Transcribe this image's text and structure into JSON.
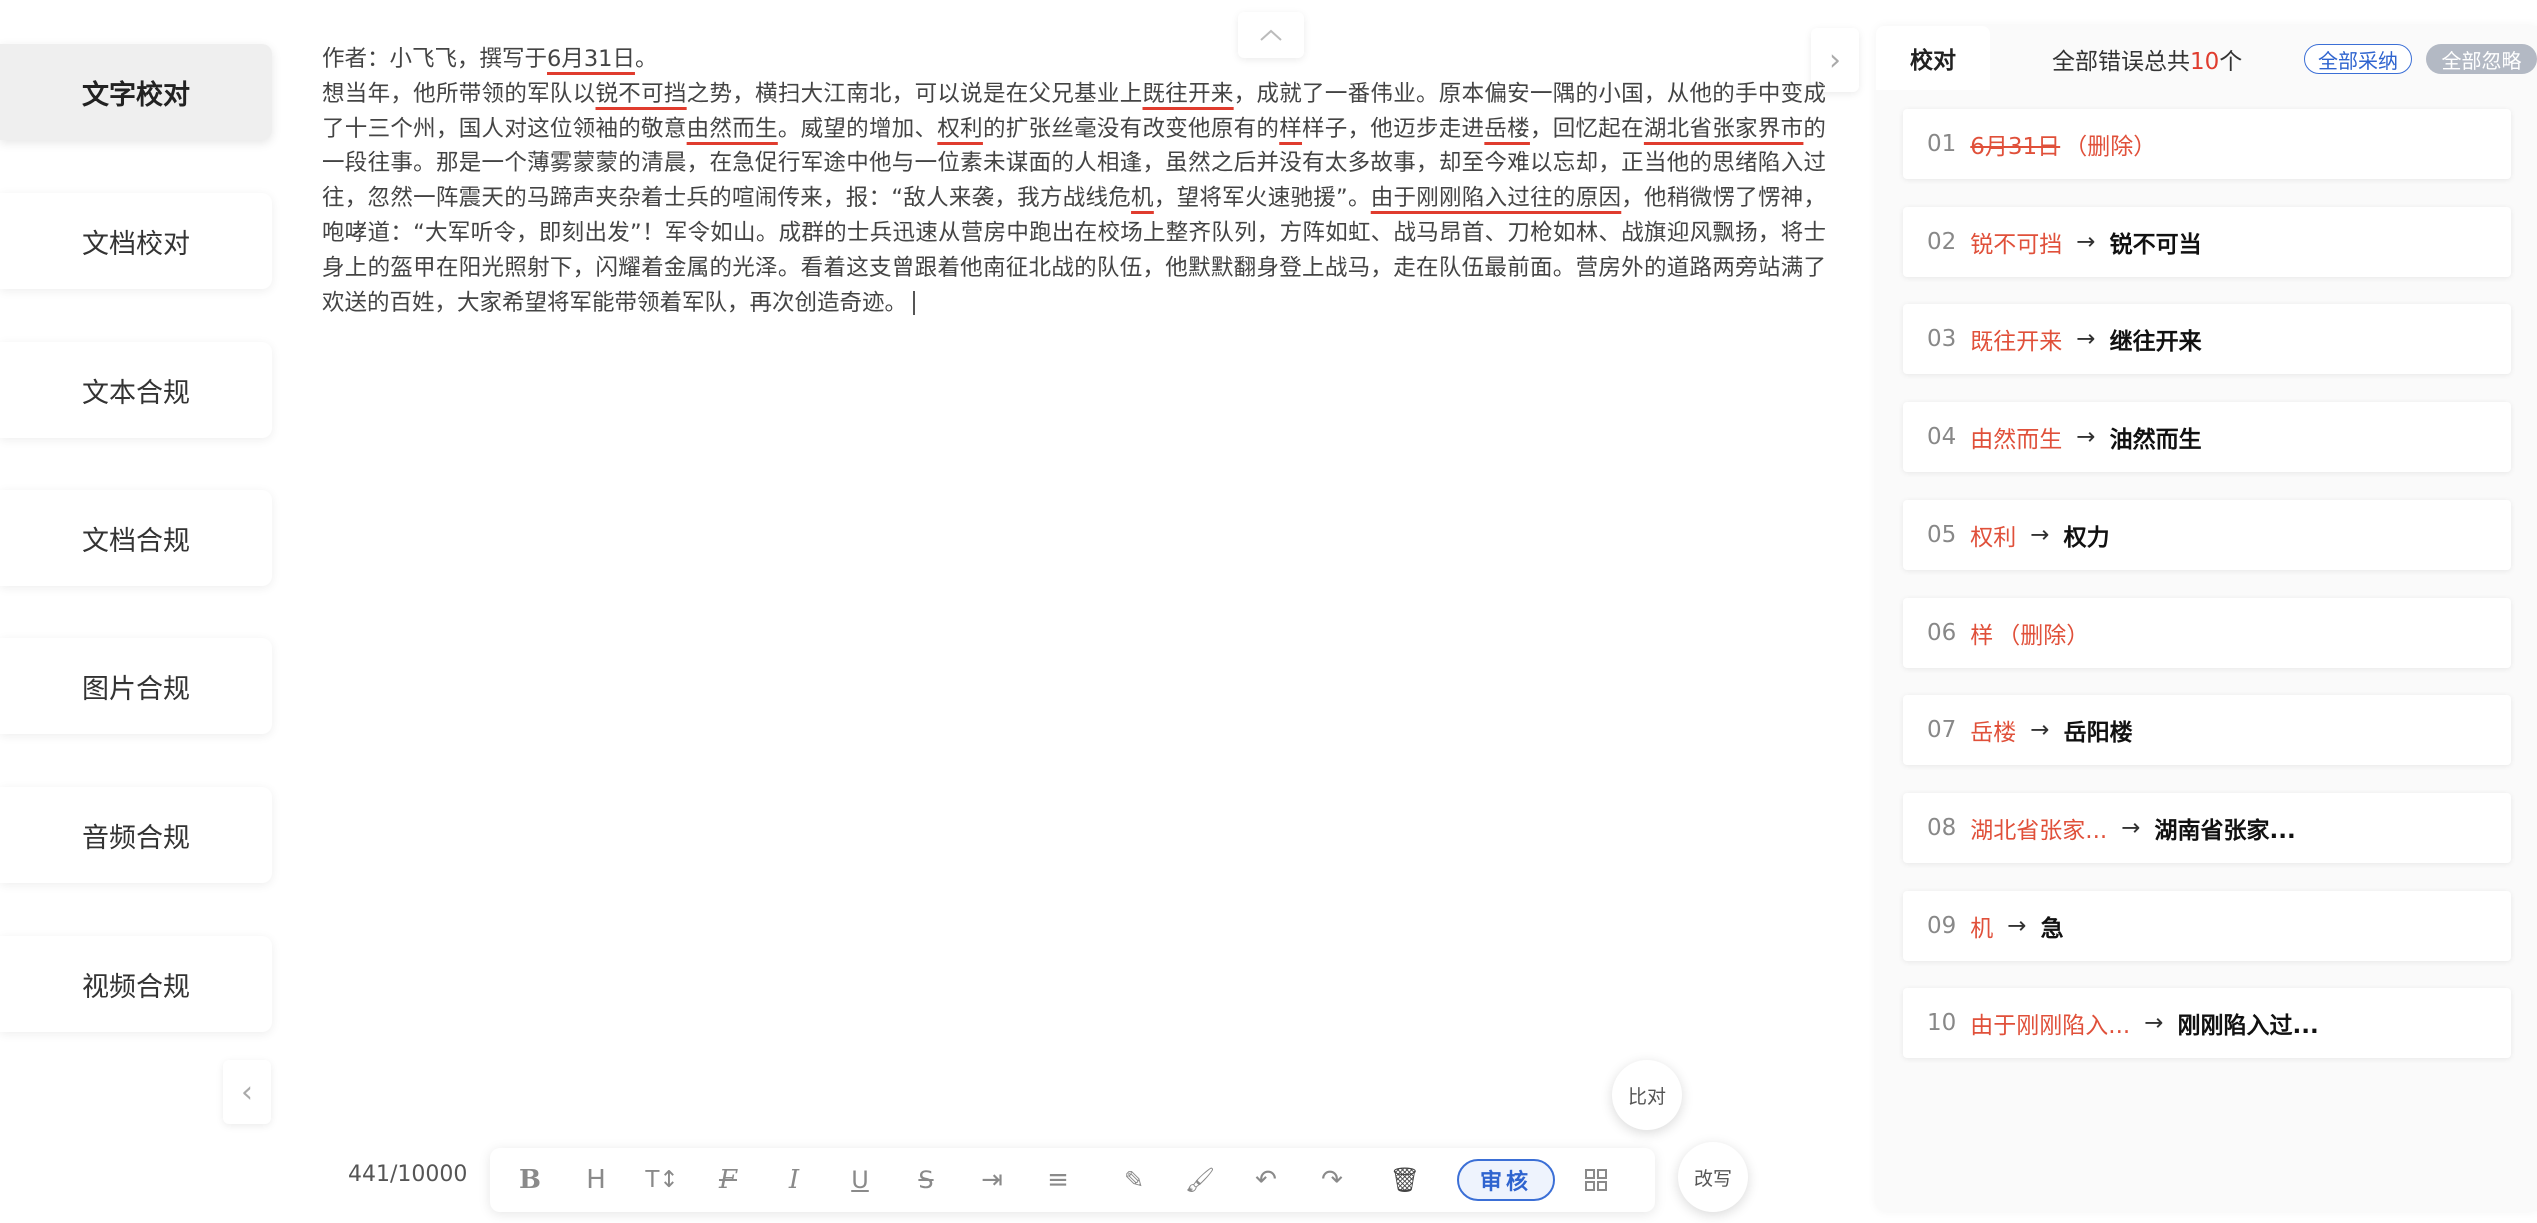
{
  "nav": {
    "items": [
      {
        "label": "文字校对",
        "active": true
      },
      {
        "label": "文档校对",
        "active": false
      },
      {
        "label": "文本合规",
        "active": false
      },
      {
        "label": "文档合规",
        "active": false
      },
      {
        "label": "图片合规",
        "active": false
      },
      {
        "label": "音频合规",
        "active": false
      },
      {
        "label": "视频合规",
        "active": false
      }
    ]
  },
  "editor": {
    "segments": [
      [
        "作者：小飞飞，撰写于",
        false
      ],
      [
        "6月31日",
        true
      ],
      [
        "。",
        false
      ],
      [
        "\n",
        false
      ],
      [
        "想当年，他所带领的军队以",
        false
      ],
      [
        "锐不可挡",
        true
      ],
      [
        "之势，横扫大江南北，可以说是在父兄基业上",
        false
      ],
      [
        "既往开来",
        true
      ],
      [
        "，成就了一番伟业。原本偏安一隅的小国，从他的手中变成了十三个州，国人对这位领袖的敬意",
        false
      ],
      [
        "由然而生",
        true
      ],
      [
        "。威望的增加、",
        false
      ],
      [
        "权利",
        true
      ],
      [
        "的扩张丝毫没有改变他原有的",
        false
      ],
      [
        "样",
        true
      ],
      [
        "样子，他迈步走进",
        false
      ],
      [
        "岳楼",
        true
      ],
      [
        "，回忆起在",
        false
      ],
      [
        "湖北省张家界市",
        true
      ],
      [
        "的一段往事。那是一个薄雾蒙蒙的清晨，在急促行军途中他与一位素未谋面的人相逢，虽然之后并没有太多故事，却至今难以忘却，正当他的思绪陷入过往，忽然一阵震天的马蹄声夹杂着士兵的喧闹传来，报：“敌人来袭，我方战线危",
        false
      ],
      [
        "机",
        true
      ],
      [
        "，望将军火速驰援”。",
        false
      ],
      [
        "由于刚刚陷入过往的原因",
        true
      ],
      [
        "，他稍微愣了愣神，咆哮道：“大军听令，即刻出发”！军令如山。成群的士兵迅速从营房中跑出在校场上整齐队列，方阵如虹、战马昂首、刀枪如林、战旗迎风飘扬，将士身上的盔甲在阳光照射下，闪耀着金属的光泽。看着这支曾跟着他南征北战的队伍，他默默翻身登上战马，走在队伍最前面。营房外的道路两旁站满了欢送的百姓，大家希望将军能带领着军队，再次创造奇迹。",
        false
      ]
    ],
    "word_count": "441/10000"
  },
  "toolbar": {
    "icons": [
      "bold-icon",
      "heading-icon",
      "font-size-icon",
      "clear-format-icon",
      "italic-icon",
      "underline-icon",
      "strikethrough-icon",
      "indent-icon",
      "align-icon",
      "highlight-pen-icon",
      "format-brush-icon",
      "undo-icon",
      "redo-icon",
      "delete-icon"
    ],
    "review_label": "审核",
    "compare_label": "比对",
    "rewrite_label": "改写"
  },
  "panel": {
    "tab_label": "校对",
    "total_prefix": "全部错误总共",
    "total_count": "10",
    "total_suffix": "个",
    "accept_all": "全部采纳",
    "ignore_all": "全部忽略",
    "items": [
      {
        "idx": "01",
        "orig": "6月31日",
        "strike": true,
        "note": "（删除）",
        "fix": ""
      },
      {
        "idx": "02",
        "orig": "锐不可挡",
        "strike": false,
        "note": "",
        "fix": "锐不可当"
      },
      {
        "idx": "03",
        "orig": "既往开来",
        "strike": false,
        "note": "",
        "fix": "继往开来"
      },
      {
        "idx": "04",
        "orig": "由然而生",
        "strike": false,
        "note": "",
        "fix": "油然而生"
      },
      {
        "idx": "05",
        "orig": "权利",
        "strike": false,
        "note": "",
        "fix": "权力"
      },
      {
        "idx": "06",
        "orig": "样",
        "strike": false,
        "note": "（删除）",
        "fix": ""
      },
      {
        "idx": "07",
        "orig": "岳楼",
        "strike": false,
        "note": "",
        "fix": "岳阳楼"
      },
      {
        "idx": "08",
        "orig": "湖北省张家...",
        "strike": false,
        "note": "",
        "fix": "湖南省张家..."
      },
      {
        "idx": "09",
        "orig": "机",
        "strike": false,
        "note": "",
        "fix": "急"
      },
      {
        "idx": "10",
        "orig": "由于刚刚陷入...",
        "strike": false,
        "note": "",
        "fix": "刚刚陷入过..."
      }
    ]
  }
}
